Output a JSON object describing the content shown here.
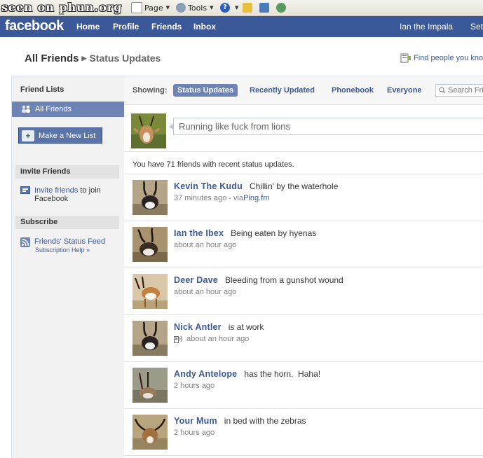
{
  "watermark": "seen on phun.org",
  "ie_toolbar": {
    "page_label": "Page",
    "tools_label": "Tools",
    "help_label": "?"
  },
  "header": {
    "logo": "facebook",
    "nav": [
      "Home",
      "Profile",
      "Friends",
      "Inbox"
    ],
    "user_name": "Ian the Impala",
    "settings_label": "Set"
  },
  "breadcrumb": {
    "root": "All Friends",
    "separator": "▶",
    "current": "Status Updates"
  },
  "find_people_label": "Find people you know",
  "sidebar": {
    "friend_lists_heading": "Friend Lists",
    "all_friends_label": "All Friends",
    "new_list_label": "Make a New List",
    "invite_heading": "Invite Friends",
    "invite_link": "Invite friends",
    "invite_text": " to join",
    "invite_text2": "Facebook",
    "subscribe_heading": "Subscribe",
    "feed_link": "Friends' Status Feed",
    "help_link": "Subscription Help »"
  },
  "filter": {
    "showing_label": "Showing:",
    "tabs": [
      "Status Updates",
      "Recently Updated",
      "Phonebook",
      "Everyone"
    ],
    "search_placeholder": "Search Fri"
  },
  "composer": {
    "input_value": "Running like fuck from lions"
  },
  "count_text": "You have 71 friends with recent status updates.",
  "updates": [
    {
      "name": "Kevin The Kudu",
      "status": "Chillin' by the waterhole",
      "time": "37 minutes ago - via ",
      "via": "Ping.fm"
    },
    {
      "name": "Ian the Ibex",
      "status": "Being eaten by hyenas",
      "time": "about an hour ago",
      "via": ""
    },
    {
      "name": "Deer Dave",
      "status": "Bleeding from a gunshot wound",
      "time": "about an hour ago",
      "via": ""
    },
    {
      "name": "Nick Antler",
      "status": "is at work",
      "time": "about an hour ago",
      "via": ""
    },
    {
      "name": "Andy Antelope",
      "status": "has the horn.  Haha!",
      "time": "2 hours ago",
      "via": ""
    },
    {
      "name": "Your Mum",
      "status": "in bed with the zebras",
      "time": "2 hours ago",
      "via": ""
    }
  ],
  "colors": {
    "fb_blue": "#3b5998",
    "selected_blue": "#6d84b4",
    "sidebar_bg": "#f2f2f2"
  }
}
